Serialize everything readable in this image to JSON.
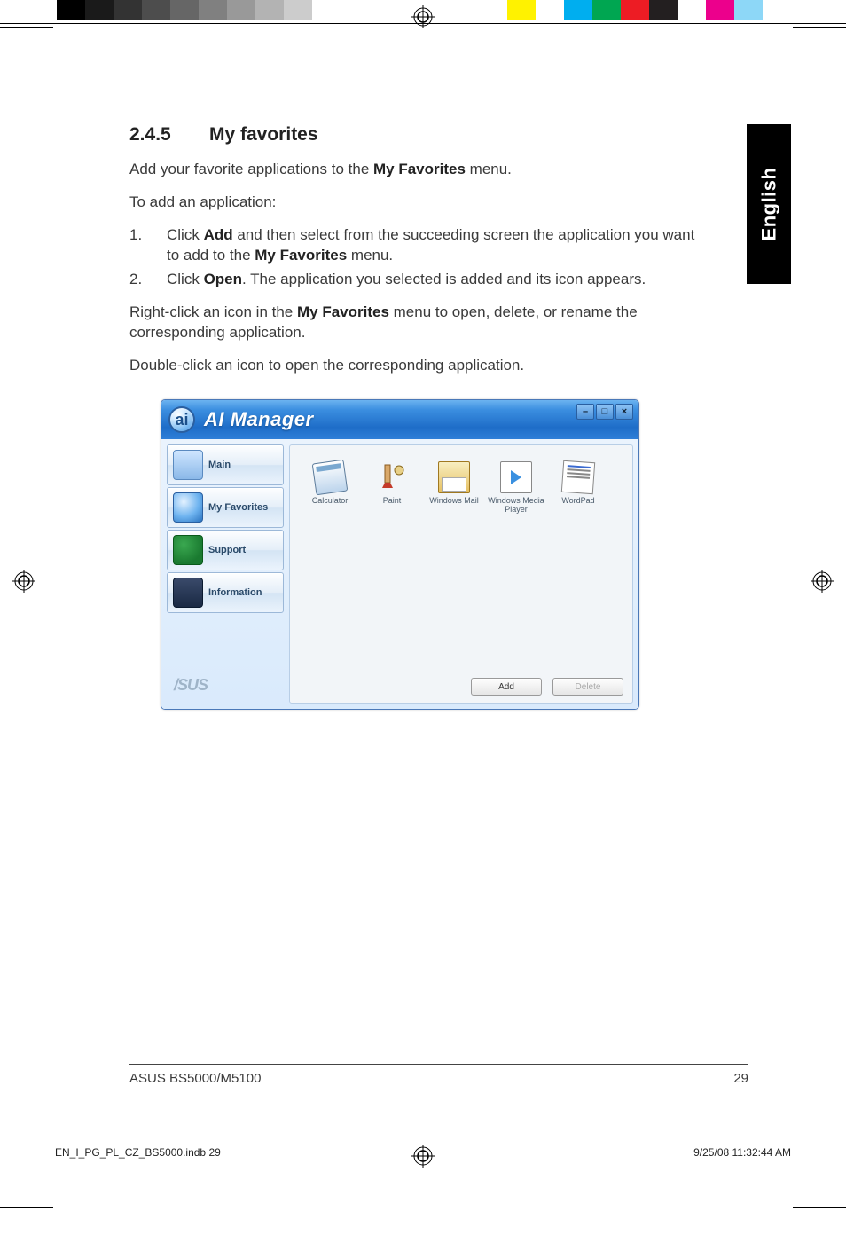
{
  "print_bar": {
    "grays": [
      "#000000",
      "#1a1a1a",
      "#333333",
      "#4d4d4d",
      "#666666",
      "#808080",
      "#999999",
      "#b3b3b3",
      "#cccccc",
      "#ffffff"
    ],
    "colors": [
      "#fff200",
      "#ffffff",
      "#00aeef",
      "#00a651",
      "#ed1c24",
      "#231f20",
      "#ffffff",
      "#ec008c",
      "#8dd7f7",
      "#ffffff"
    ]
  },
  "language_tab": "English",
  "section": {
    "number": "2.4.5",
    "title": "My favorites",
    "intro_pre": "Add your favorite applications to the ",
    "intro_b": "My Favorites",
    "intro_post": " menu.",
    "subhead": "To add an application:",
    "steps": [
      {
        "n": "1.",
        "pre": "Click ",
        "b1": "Add",
        "mid": " and then select from the succeeding screen the application you want to add to the ",
        "b2": "My Favorites",
        "post": " menu."
      },
      {
        "n": "2.",
        "pre": "Click ",
        "b1": "Open",
        "mid": ". The application you selected is added and its icon appears.",
        "b2": "",
        "post": ""
      }
    ],
    "p3_pre": "Right-click an icon in the ",
    "p3_b": "My Favorites",
    "p3_post": " menu to open, delete, or rename the corresponding application.",
    "p4": "Double-click an icon to open the corresponding application."
  },
  "window": {
    "logo_glyph": "ai",
    "title": "AI Manager",
    "btn_min": "–",
    "btn_max": "□",
    "btn_close": "×",
    "sidebar": [
      {
        "label": "Main"
      },
      {
        "label": "My Favorites"
      },
      {
        "label": "Support"
      },
      {
        "label": "Information"
      }
    ],
    "asus_logo": "/SUS",
    "apps": [
      {
        "label": "Calculator"
      },
      {
        "label": "Paint"
      },
      {
        "label": "Windows Mail"
      },
      {
        "label": "Windows Media Player"
      },
      {
        "label": "WordPad"
      }
    ],
    "add_btn": "Add",
    "delete_btn": "Delete"
  },
  "footer": {
    "left": "ASUS BS5000/M5100",
    "right": "29"
  },
  "imprint": {
    "file": "EN_I_PG_PL_CZ_BS5000.indb   29",
    "date": "9/25/08   11:32:44 AM"
  }
}
